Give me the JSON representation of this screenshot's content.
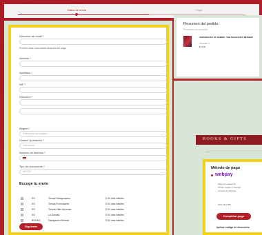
{
  "steps": {
    "step1": "Datos de envío",
    "step2": "Pago"
  },
  "form": {
    "email_label": "Dirección de email *",
    "email_help": "Puedes crear una cuenta después del pago.",
    "name_label": "Nombre *",
    "surname_label": "Apellidos *",
    "nif_label": "NIF *",
    "address_label": "Dirección *",
    "region_label": "Región *",
    "region_placeholder": "Seleccione una región",
    "city_label": "Ciudad / población *",
    "city_placeholder": "Seleccione",
    "phone_label": "Número de teléfono *",
    "doc_label": "Tipo de documento *",
    "doc_placeholder": "NIF/CIF",
    "shipping_title": "Escoge tu envío",
    "shipping_options": [
      {
        "c1": "ES",
        "c2": "Tienda Saragossano",
        "c3": "5.00 días hábiles"
      },
      {
        "c1": "ES",
        "c2": "Tienda Formosante",
        "c3": "5.00 días hábiles"
      },
      {
        "c1": "ES",
        "c2": "Tienda Villa Hermosa",
        "c3": "5.00 días hábiles"
      },
      {
        "c1": "ES",
        "c2": "La Dorada",
        "c3": "5.00 días hábiles"
      },
      {
        "c1": "BOOKS",
        "c2": "Delegación Bermat",
        "c3": "5.00 días hábiles"
      }
    ],
    "next_button": "Siguiente"
  },
  "summary": {
    "title": "Resumen del pedido",
    "subtitle": "Productos en tu carrito",
    "item_name": "CHRONICLES OF NARNIA: THE MAGICIAN'S NEPHEW",
    "item_qty": "Cantidad: 1",
    "item_price": "$24.99"
  },
  "banner": {
    "text": "BOOKS & GIFTS"
  },
  "payment": {
    "title": "Método de pago",
    "brand": "webpay",
    "desc1": "Paga con tarjeta de",
    "desc2": "crédito, débito o prepago",
    "desc3": "a través de Webpay",
    "total": "Total: $24.990",
    "button": "Completar pago",
    "coupon": "Aplicar código de descuento"
  },
  "colors": {
    "accent_red": "#b3202a",
    "border_yellow": "#f2d21a",
    "mint": "#d8e6d8"
  }
}
